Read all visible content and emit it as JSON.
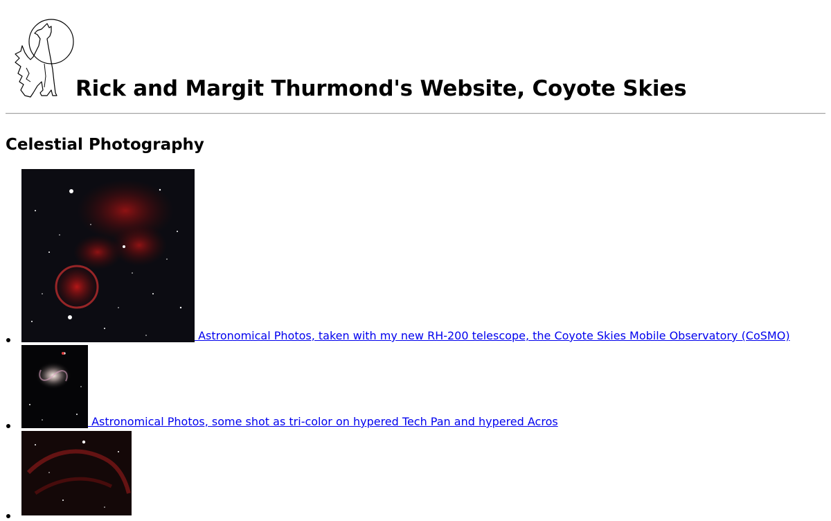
{
  "header": {
    "logo_icon": "howling-coyote-moon-icon",
    "title": "Rick and Margit Thurmond's Website, Coyote Skies"
  },
  "section": {
    "title": "Celestial Photography"
  },
  "links": [
    {
      "caption": " Astronomical Photos, taken with my new RH-200 telescope, the Coyote Skies Mobile Observatory (CoSMO)",
      "thumbnail": "nebula-jellyfish-photo"
    },
    {
      "caption": " Astronomical Photos, some shot as tri-color on hypered Tech Pan and hypered Acros",
      "thumbnail": "spiral-galaxy-photo"
    },
    {
      "caption": "",
      "thumbnail": "red-nebula-starfield-photo"
    }
  ],
  "colors": {
    "link": "#0000ee",
    "rule": "#a0a0a0"
  }
}
